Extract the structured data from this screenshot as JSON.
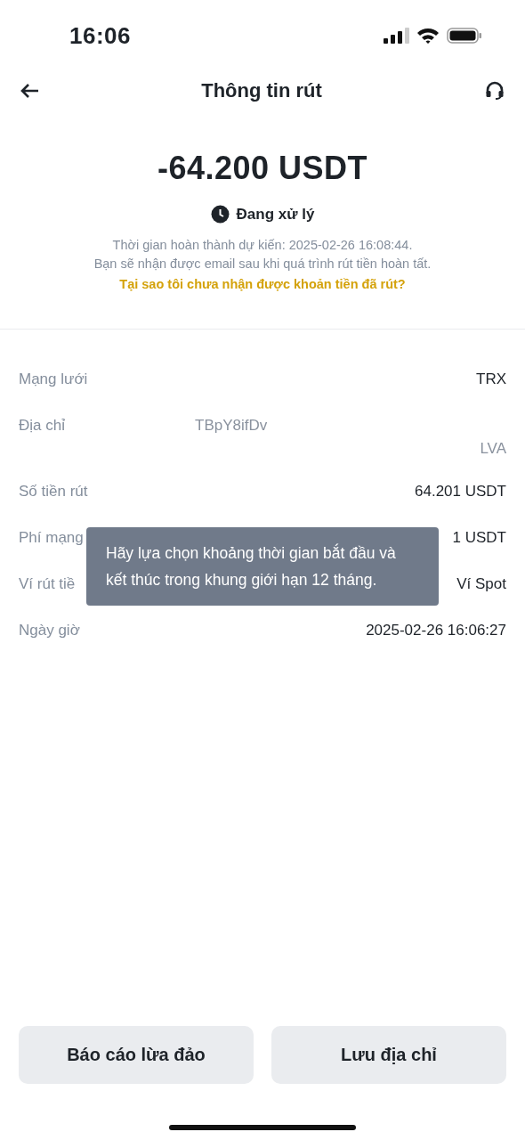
{
  "status_bar": {
    "time": "16:06"
  },
  "header": {
    "title": "Thông tin rút"
  },
  "summary": {
    "amount": "-64.200 USDT",
    "status": "Đang xử lý",
    "notes": [
      "Thời gian hoàn thành dự kiến: 2025-02-26 16:08:44.",
      "Bạn sẽ nhận được email sau khi quá trình rút tiền hoàn tất."
    ],
    "link": "Tại sao tôi chưa nhận được khoản tiền đã rút?"
  },
  "details": [
    {
      "label": "Mạng lưới",
      "value": "TRX"
    },
    {
      "label": "Địa chỉ",
      "value_lines": [
        "TBpY8ifDv",
        "LVA"
      ]
    },
    {
      "label": "Số tiền rút",
      "value": "64.201 USDT"
    },
    {
      "label": "Phí mạng",
      "value": "1 USDT"
    },
    {
      "label": "Ví rút tiề",
      "value": "Ví Spot"
    },
    {
      "label": "Ngày giờ",
      "value": "2025-02-26 16:06:27"
    }
  ],
  "tooltip": {
    "text": "Hãy lựa chọn khoảng thời gian bắt đầu và kết thúc trong khung giới hạn 12 tháng."
  },
  "buttons": [
    "Báo cáo lừa đảo",
    "Lưu địa chỉ"
  ]
}
